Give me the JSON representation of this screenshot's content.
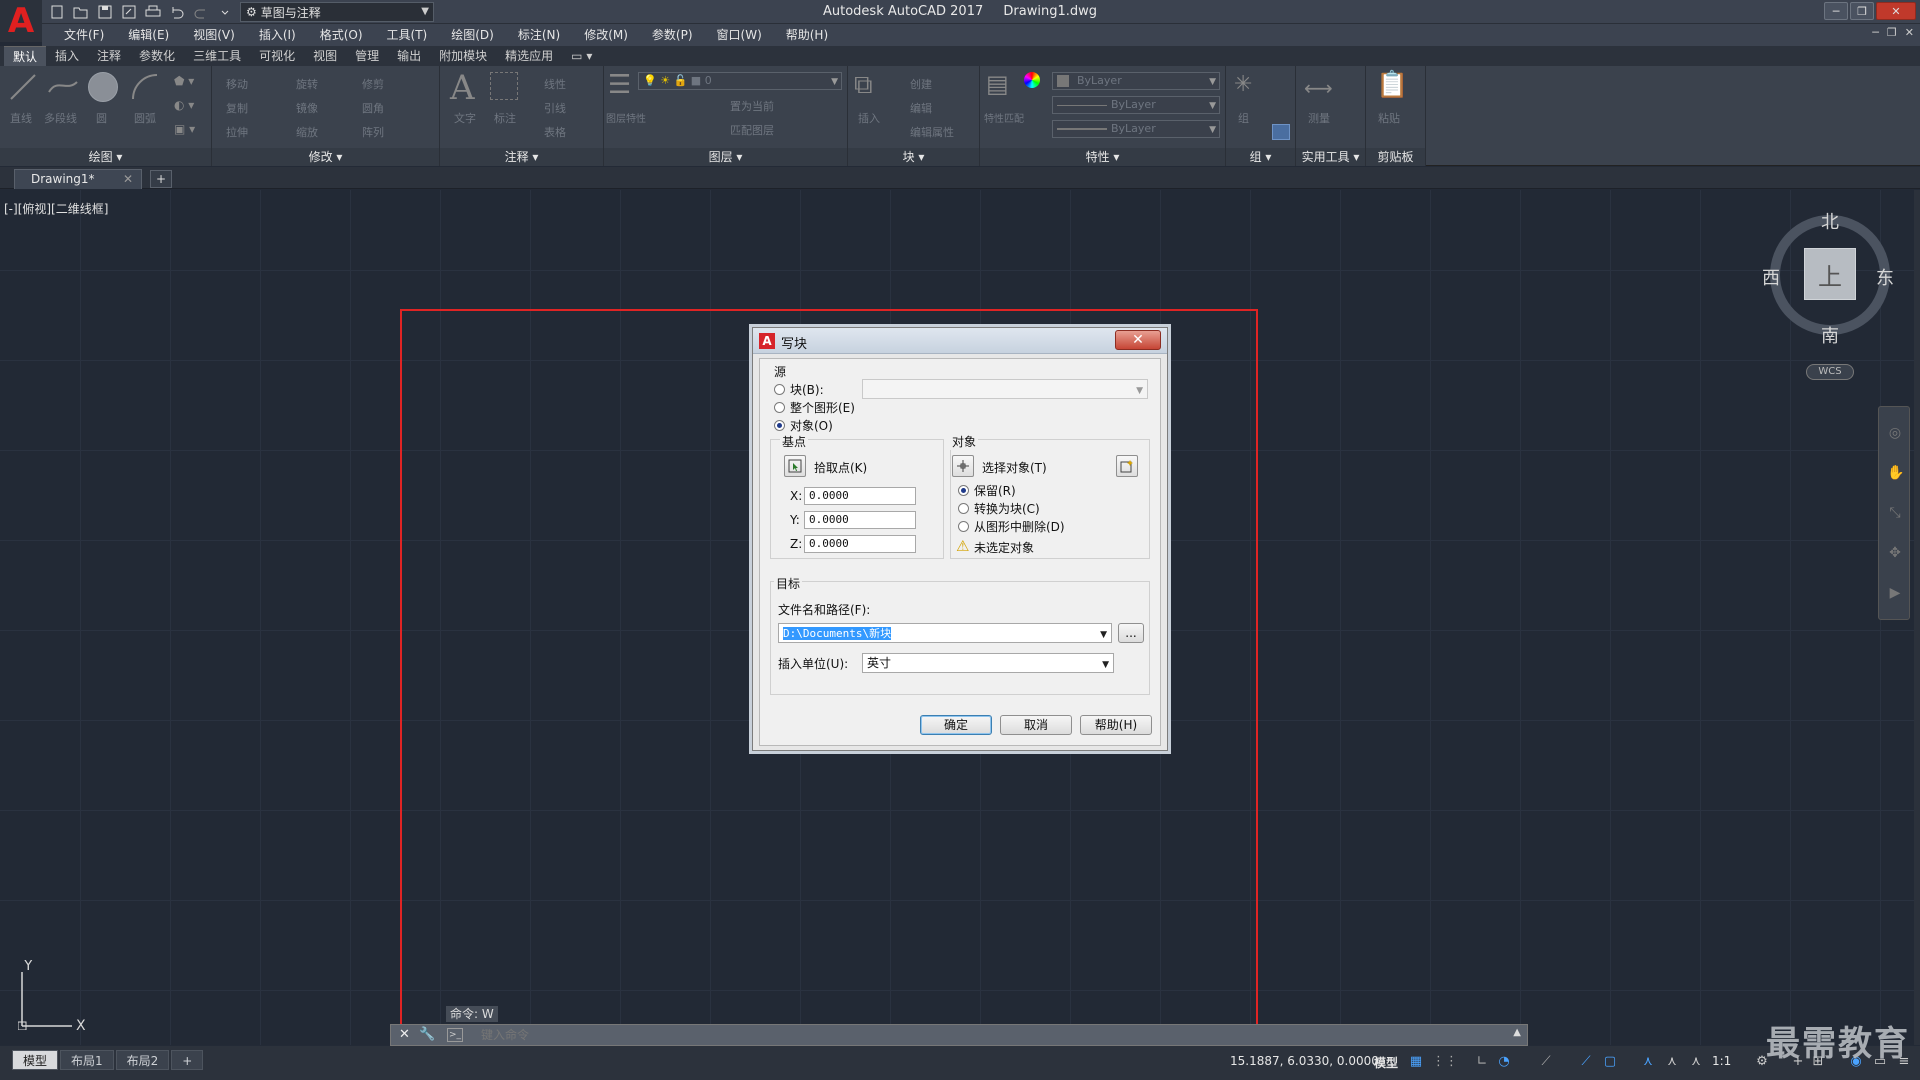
{
  "app": {
    "logo": "A",
    "title": "Autodesk AutoCAD 2017",
    "document": "Drawing1.dwg",
    "workspace": "草图与注释"
  },
  "menu": [
    "文件(F)",
    "编辑(E)",
    "视图(V)",
    "插入(I)",
    "格式(O)",
    "工具(T)",
    "绘图(D)",
    "标注(N)",
    "修改(M)",
    "参数(P)",
    "窗口(W)",
    "帮助(H)"
  ],
  "ribbon_tabs": [
    "默认",
    "插入",
    "注释",
    "参数化",
    "三维工具",
    "可视化",
    "视图",
    "管理",
    "输出",
    "附加模块",
    "精选应用"
  ],
  "ribbon": {
    "draw": {
      "title": "绘图",
      "buttons": [
        "直线",
        "多段线",
        "圆",
        "圆弧"
      ]
    },
    "modify": {
      "title": "修改",
      "buttons": [
        "移动",
        "旋转",
        "修剪",
        "复制",
        "镜像",
        "圆角",
        "拉伸",
        "缩放",
        "阵列"
      ]
    },
    "annotation": {
      "title": "注释",
      "buttons": [
        "文字",
        "标注",
        "线性",
        "引线",
        "表格"
      ]
    },
    "layers": {
      "title": "图层",
      "buttons": [
        "图层特性",
        "置为当前",
        "匹配图层"
      ],
      "current_layer": "0"
    },
    "block": {
      "title": "块",
      "buttons": [
        "插入",
        "创建",
        "编辑",
        "编辑属性"
      ]
    },
    "properties": {
      "title": "特性",
      "buttons": [
        "特性匹配"
      ],
      "color": "ByLayer",
      "linetype": "ByLayer",
      "lineweight": "ByLayer"
    },
    "groups": {
      "title": "组",
      "buttons": [
        "组"
      ]
    },
    "utilities": {
      "title": "实用工具",
      "buttons": [
        "测量"
      ]
    },
    "clipboard": {
      "title": "剪贴板",
      "buttons": [
        "粘贴"
      ]
    }
  },
  "file_tab": {
    "name": "Drawing1*"
  },
  "viewport_label": "[-][俯视][二维线框]",
  "viewcube": {
    "north": "北",
    "south": "南",
    "east": "东",
    "west": "西",
    "face": "上",
    "wcs": "WCS"
  },
  "ucs": {
    "y": "Y",
    "x": "X"
  },
  "dialog": {
    "title": "写块",
    "source": {
      "label": "源",
      "options": [
        "块(B):",
        "整个图形(E)",
        "对象(O)"
      ],
      "selected": 2
    },
    "base_point": {
      "label": "基点",
      "pick_button": "拾取点(K)",
      "x_label": "X:",
      "x": "0.0000",
      "y_label": "Y:",
      "y": "0.0000",
      "z_label": "Z:",
      "z": "0.0000"
    },
    "objects": {
      "label": "对象",
      "select_button": "选择对象(T)",
      "options": [
        "保留(R)",
        "转换为块(C)",
        "从图形中删除(D)"
      ],
      "selected": 0,
      "warning": "未选定对象"
    },
    "destination": {
      "label": "目标",
      "path_label": "文件名和路径(F):",
      "path": "D:\\Documents\\新块",
      "browse": "...",
      "units_label": "插入单位(U):",
      "units": "英寸"
    },
    "buttons": {
      "ok": "确定",
      "cancel": "取消",
      "help": "帮助(H)"
    }
  },
  "command": {
    "history": "命令: W",
    "placeholder": "键入命令"
  },
  "status": {
    "layout_tabs": [
      "模型",
      "布局1",
      "布局2"
    ],
    "coords": "15.1887, 6.0330, 0.0000",
    "model": "模型",
    "scale": "1:1"
  },
  "watermark": "最需教育",
  "colors": {
    "highlight": "#e02424",
    "canvas": "#222935",
    "accent": "#4aa3ff"
  }
}
